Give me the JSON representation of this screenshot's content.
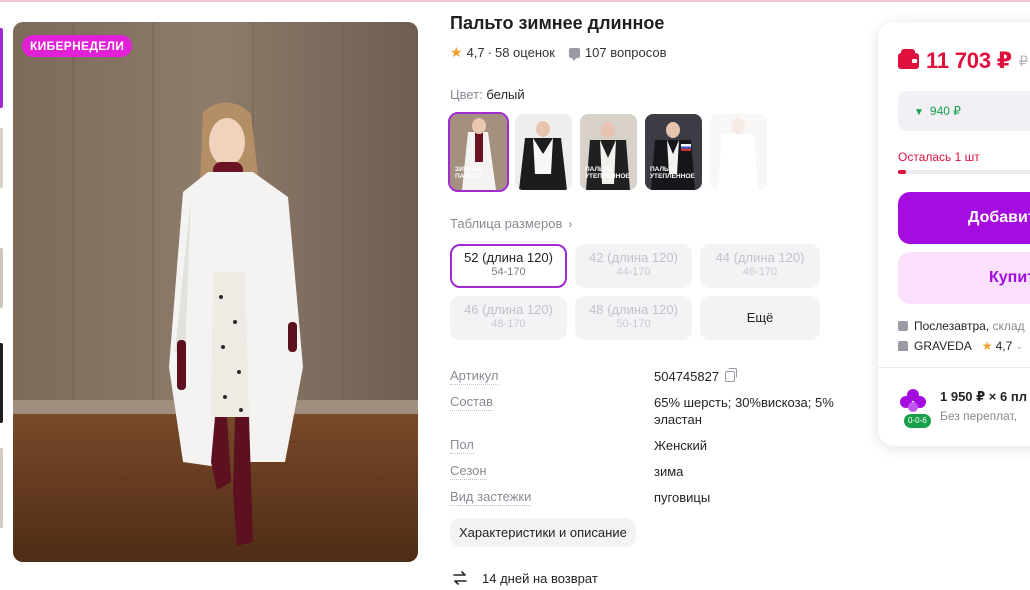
{
  "colors": {
    "accent": "#a12bd0",
    "promo": "#e220d6",
    "price": "#e0103c",
    "discount_green": "#1aa04a",
    "star": "#f49d2a"
  },
  "gallery": {
    "promo_badge": "КИБЕРНЕДЕЛИ",
    "swatch_captions": [
      "ЗИМНЕЕ ПАЛЬТО",
      "",
      "ПАЛЬТО УТЕПЛЁННОЕ",
      "ПАЛЬТО УТЕПЛЁННОЕ",
      ""
    ]
  },
  "product": {
    "title": "Пальто зимнее длинное",
    "rating": "4,7",
    "reviews": "58 оценок",
    "questions": "107 вопросов",
    "color_label": "Цвет:",
    "color_value": "белый"
  },
  "sizes": {
    "table_link": "Таблица размеров",
    "items": [
      {
        "size": "52 (длина 120)",
        "ru": "54-170",
        "state": "selected"
      },
      {
        "size": "42 (длина 120)",
        "ru": "44-170",
        "state": "unavailable"
      },
      {
        "size": "44 (длина 120)",
        "ru": "46-170",
        "state": "unavailable"
      },
      {
        "size": "46 (длина 120)",
        "ru": "48-170",
        "state": "unavailable"
      },
      {
        "size": "48 (длина 120)",
        "ru": "50-170",
        "state": "unavailable"
      }
    ],
    "more_label": "Ещё"
  },
  "specs": [
    {
      "key": "Артикул",
      "value": "504745827"
    },
    {
      "key": "Состав",
      "value": "65% шерсть; 30%вискоза; 5% эластан"
    },
    {
      "key": "Пол",
      "value": "Женский"
    },
    {
      "key": "Сезон",
      "value": "зима"
    },
    {
      "key": "Вид застежки",
      "value": "пуговицы"
    }
  ],
  "description_button": "Характеристики и описание",
  "return_policy": "14 дней на возврат",
  "buy_card": {
    "price": "11 703 ₽",
    "old_price": "₽",
    "discount": "940 ₽",
    "stock_left": "Осталась 1 шт",
    "stock_fraction": 0.04,
    "add_to_cart": "Добавит",
    "buy_now": "Купит",
    "delivery": "Послезавтра,",
    "delivery_extra": "склад",
    "seller": "GRAVEDA",
    "seller_rating": "4,7",
    "installment": "1 950 ₽ × 6 пл",
    "installment_note": "Без переплат,",
    "installment_badge": "0-0-6"
  }
}
